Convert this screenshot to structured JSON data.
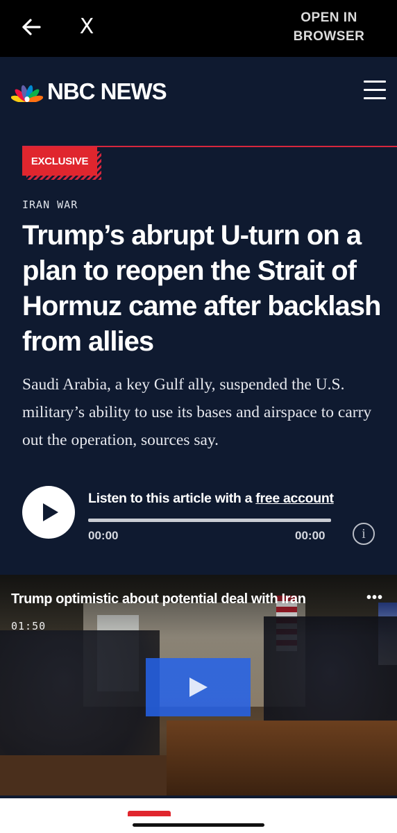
{
  "browser_bar": {
    "close_label": "X",
    "open_in_browser": "OPEN IN BROWSER"
  },
  "header": {
    "brand": "NBC NEWS",
    "peacock_colors": [
      "#fccc12",
      "#ef1541",
      "#6460aa",
      "#0089d0",
      "#0db14b",
      "#ff7112"
    ]
  },
  "article": {
    "badge": "EXCLUSIVE",
    "kicker": "IRAN WAR",
    "headline": "Trump’s abrupt U-turn on a plan to reopen the Strait of Hormuz came after backlash from allies",
    "dek": "Saudi Arabia, a key Gulf ally, suspended the U.S. military’s ability to use its bases and airspace to carry out the operation, sources say."
  },
  "audio_player": {
    "prompt": "Listen to this article with a ",
    "link_text": "free account",
    "current_time": "00:00",
    "duration": "00:00",
    "progress": 0
  },
  "video": {
    "title": "Trump optimistic about potential deal with Iran",
    "duration": "01:50",
    "more_label": "•••"
  },
  "colors": {
    "background": "#0f1a30",
    "accent_red": "#e0262e",
    "play_overlay": "#2563eb"
  }
}
